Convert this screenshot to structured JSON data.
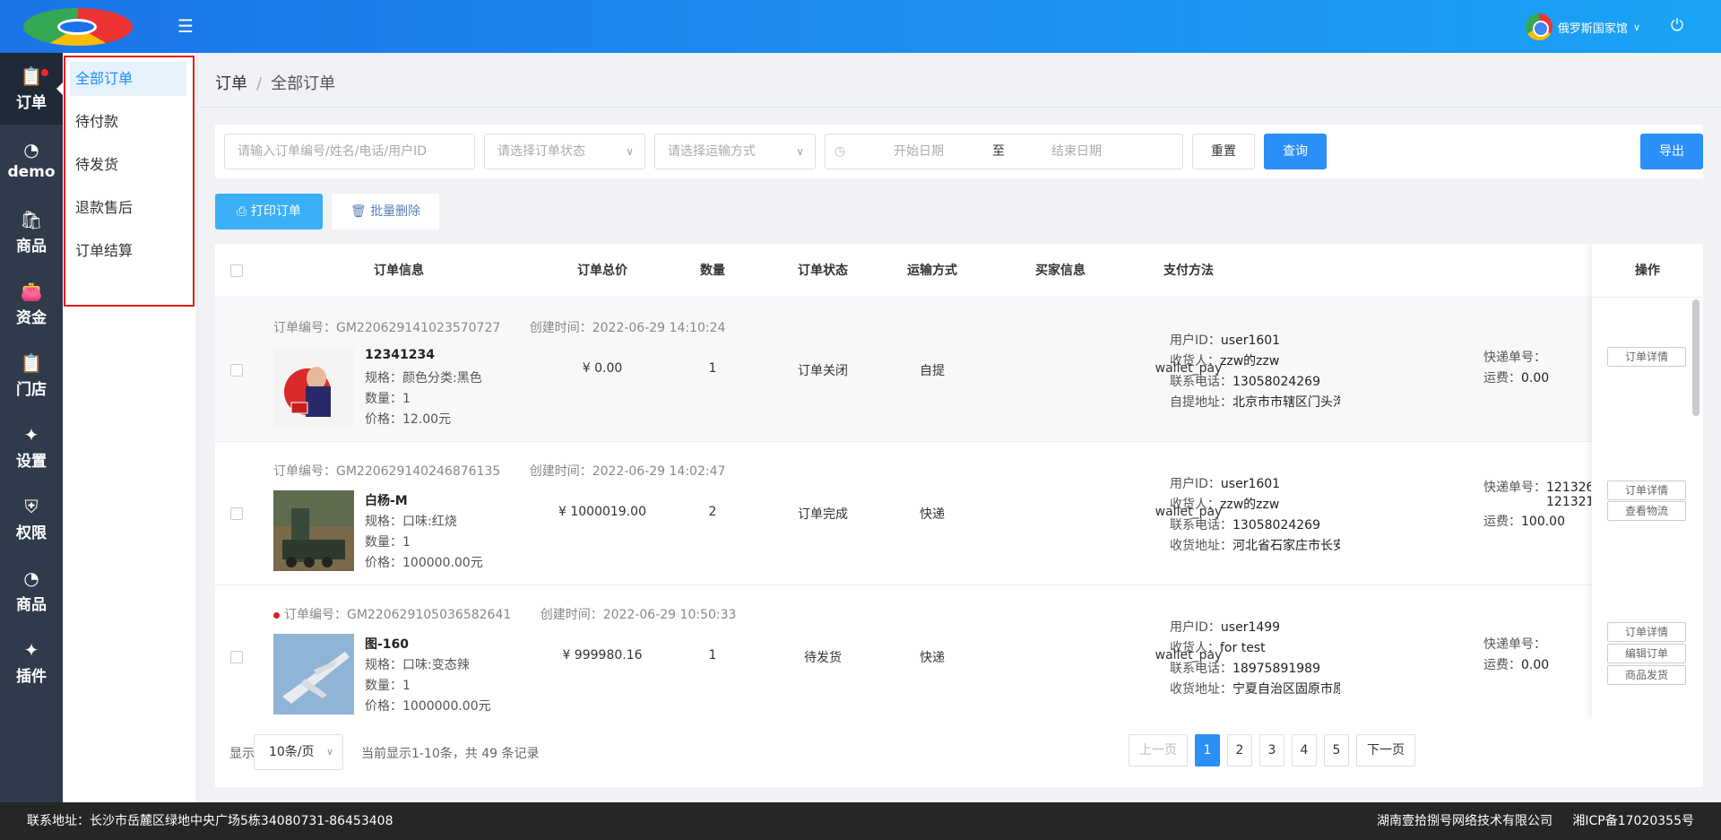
{
  "header": {
    "user_name": "俄罗斯国家馆"
  },
  "iconbar": [
    {
      "label": "订单",
      "icon": "clipboard-icon"
    },
    {
      "label": "demo",
      "icon": "pie-chart-icon"
    },
    {
      "label": "商品",
      "icon": "shopping-bag-icon"
    },
    {
      "label": "资金",
      "icon": "wallet-icon"
    },
    {
      "label": "门店",
      "icon": "clipboard-icon"
    },
    {
      "label": "设置",
      "icon": "puzzle-icon"
    },
    {
      "label": "权限",
      "icon": "shield-icon"
    },
    {
      "label": "商品",
      "icon": "pie-chart-icon"
    },
    {
      "label": "插件",
      "icon": "puzzle-icon"
    }
  ],
  "submenu": [
    "全部订单",
    "待付款",
    "待发货",
    "退款售后",
    "订单结算"
  ],
  "breadcrumb": {
    "root": "订单",
    "current": "全部订单"
  },
  "filters": {
    "keyword_placeholder": "请输入订单编号/姓名/电话/用户ID",
    "status_placeholder": "请选择订单状态",
    "shipping_placeholder": "请选择运输方式",
    "start_placeholder": "开始日期",
    "range_sep": "至",
    "end_placeholder": "结束日期",
    "reset": "重置",
    "query": "查询",
    "export": "导出"
  },
  "actions": {
    "print": "打印订单",
    "batch_delete": "批量删除"
  },
  "table": {
    "columns": [
      "订单信息",
      "订单总价",
      "数量",
      "订单状态",
      "运输方式",
      "买家信息",
      "支付方法",
      "操作"
    ],
    "labels": {
      "order_no": "订单编号：",
      "created": "创建时间：",
      "spec": "规格：",
      "qty": "数量：",
      "price": "价格：",
      "user_id": "用户ID：",
      "receiver": "收货人：",
      "phone": "联系电话：",
      "tracking": "快递单号：",
      "freight": "运费："
    },
    "rows": [
      {
        "order_no": "GM220629141023570727",
        "created": "2022-06-29 14:10:24",
        "title": "12341234",
        "spec": "颜色分类:黑色",
        "qty": "1",
        "price": "12.00元",
        "total": "¥ 0.00",
        "count": "1",
        "status": "订单关闭",
        "shipping": "自提",
        "user_id": "user1601",
        "receiver": "zzw的zzw",
        "phone": "13058024269",
        "addr_label": "自提地址：",
        "address": "北京市市辖区门头沟",
        "pay": "wallet_pay",
        "tracking": "",
        "tracking2": "",
        "freight": "0.00",
        "ops": [
          "订单详情"
        ]
      },
      {
        "order_no": "GM220629140246876135",
        "created": "2022-06-29 14:02:47",
        "title": "白杨-M",
        "spec": "口味:红烧",
        "qty": "1",
        "price": "100000.00元",
        "total": "¥ 1000019.00",
        "count": "2",
        "status": "订单完成",
        "shipping": "快递",
        "user_id": "user1601",
        "receiver": "zzw的zzw",
        "phone": "13058024269",
        "addr_label": "收货地址：",
        "address": "河北省石家庄市长安",
        "pay": "wallet_pay",
        "tracking": "121326",
        "tracking2": "121321",
        "freight": "100.00",
        "ops": [
          "订单详情",
          "查看物流"
        ]
      },
      {
        "order_no": "GM220629105036582641",
        "created": "2022-06-29 10:50:33",
        "title": "图-160",
        "spec": "口味:变态辣",
        "qty": "1",
        "price": "1000000.00元",
        "total": "¥ 999980.16",
        "count": "1",
        "status": "待发货",
        "shipping": "快递",
        "user_id": "user1499",
        "receiver": "for test",
        "phone": "18975891989",
        "addr_label": "收货地址：",
        "address": "宁夏自治区固原市原",
        "pay": "wallet_pay",
        "tracking": "",
        "tracking2": "",
        "freight": "0.00",
        "ops": [
          "订单详情",
          "编辑订单",
          "商品发货"
        ]
      }
    ]
  },
  "pagination": {
    "show_label": "显示",
    "page_size": "10条/页",
    "summary": "当前显示1-10条，共 49 条记录",
    "prev": "上一页",
    "pages": [
      "1",
      "2",
      "3",
      "4",
      "5"
    ],
    "current": "1",
    "next": "下一页"
  },
  "footer": {
    "address": "联系地址：长沙市岳麓区绿地中央广场5栋34080731-86453408",
    "company": "湖南壹拾捌号网络技术有限公司",
    "icp": "湘ICP备17020355号"
  }
}
